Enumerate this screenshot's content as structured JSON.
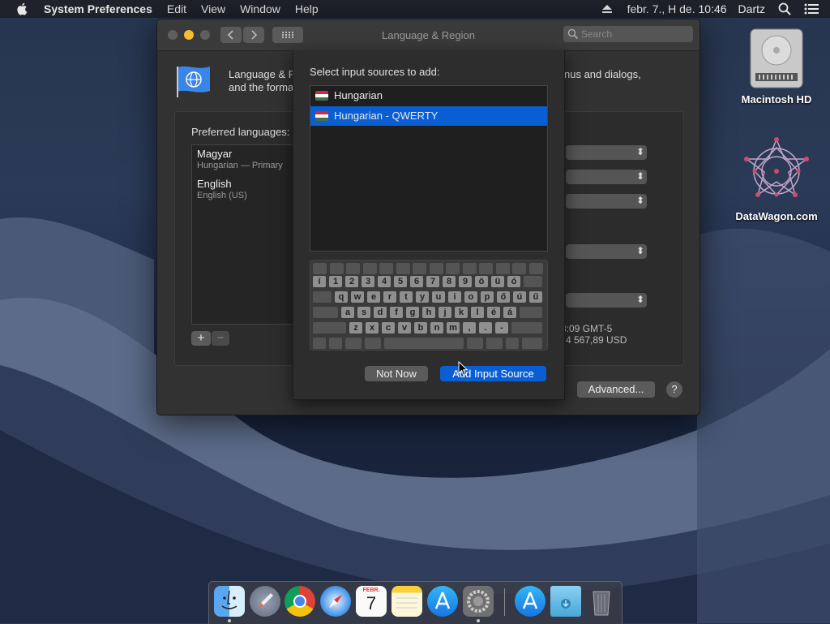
{
  "menubar": {
    "app_name": "System Preferences",
    "items": [
      "Edit",
      "View",
      "Window",
      "Help"
    ],
    "datetime": "febr. 7., H de.  10:46",
    "user": "Dartz"
  },
  "window": {
    "title": "Language & Region",
    "search_placeholder": "Search",
    "intro_line1": "Language & R",
    "intro_line1_tail": "nus and dialogs,",
    "intro_line2": "and the forma",
    "preferred_label": "Preferred languages:",
    "languages": [
      {
        "name": "Magyar",
        "sub": "Hungarian — Primary"
      },
      {
        "name": "English",
        "sub": "English (US)"
      }
    ],
    "time_sample": "3:09 GMT-5",
    "number_sample": "4 567,89 USD",
    "advanced_label": "Advanced...",
    "help_label": "?",
    "add_label": "+",
    "remove_label": "−"
  },
  "sheet": {
    "title": "Select input sources to add:",
    "sources": [
      {
        "label": "Hungarian",
        "selected": false
      },
      {
        "label": "Hungarian - QWERTY",
        "selected": true
      }
    ],
    "keyboard_rows": [
      [
        "í",
        "1",
        "2",
        "3",
        "4",
        "5",
        "6",
        "7",
        "8",
        "9",
        "ö",
        "ü",
        "ó"
      ],
      [
        "q",
        "w",
        "e",
        "r",
        "t",
        "y",
        "u",
        "i",
        "o",
        "p",
        "ő",
        "ú",
        "ű"
      ],
      [
        "a",
        "s",
        "d",
        "f",
        "g",
        "h",
        "j",
        "k",
        "l",
        "é",
        "á"
      ],
      [
        "z",
        "x",
        "c",
        "v",
        "b",
        "n",
        "m",
        ",",
        ".",
        "-"
      ]
    ],
    "not_now_label": "Not Now",
    "add_source_label": "Add Input Source"
  },
  "desktop": {
    "icons": [
      {
        "label": "Macintosh HD",
        "icon": "hard-drive-icon"
      },
      {
        "label": "DataWagon.com",
        "icon": "datawagon-logo-icon"
      }
    ]
  },
  "dock": {
    "items": [
      "finder-icon",
      "launchpad-icon",
      "chrome-icon",
      "safari-icon",
      "calendar-icon",
      "notes-icon",
      "app-store-icon",
      "system-preferences-icon",
      "app-store-downloads-icon",
      "downloads-folder-icon",
      "trash-icon"
    ],
    "calendar_month": "FEBR.",
    "calendar_day": "7"
  },
  "colors": {
    "accent": "#0a5ed4",
    "window_bg": "#323232",
    "traffic_red": "#5e5e5e",
    "traffic_yellow": "#f4bd2f",
    "traffic_green": "#5e5e5e"
  }
}
